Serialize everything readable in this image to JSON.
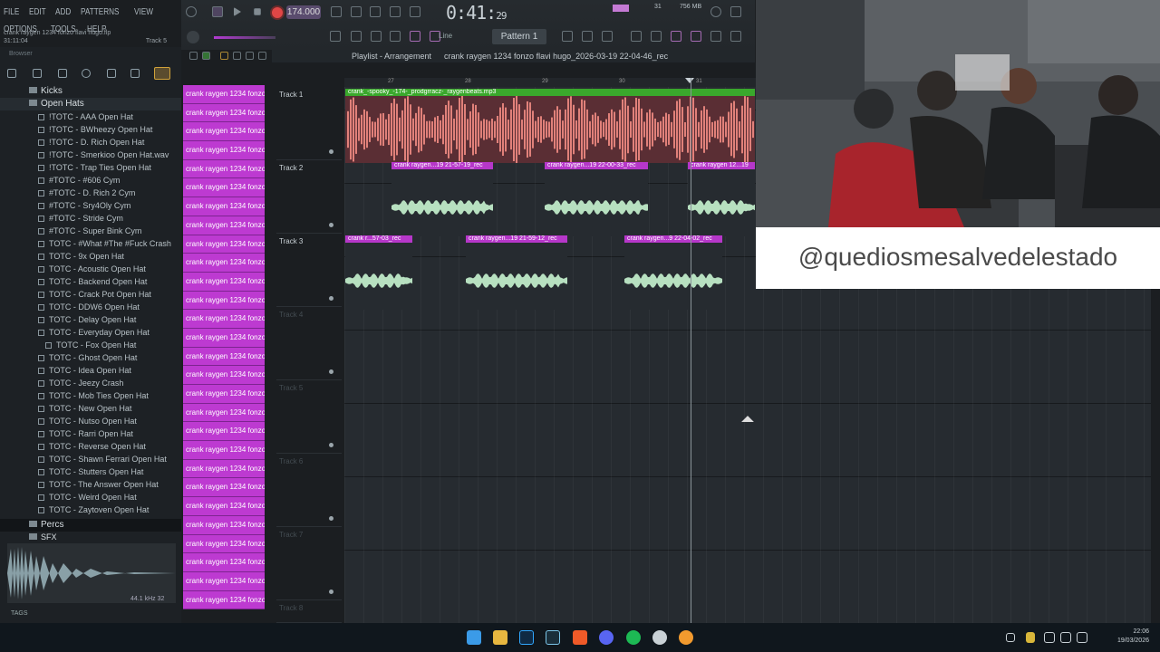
{
  "menu": [
    "FILE",
    "EDIT",
    "ADD",
    "PATTERNS",
    "VIEW",
    "OPTIONS",
    "TOOLS",
    "HELP"
  ],
  "hint": {
    "file": "crank raygen 1234 fonzo flavi hugo.flp",
    "time": "31:11:04",
    "track": "Track 5"
  },
  "transport": {
    "tempo": "174.000",
    "time": "0:41",
    "time_small": "29",
    "pattern": "Pattern 1",
    "snap": "Line",
    "mem": "756 MB",
    "cpu": "31"
  },
  "playlist": {
    "title": "Playlist - Arrangement",
    "name": "crank raygen 1234 fonzo flavi hugo_2026-03-19 22-04-46_rec",
    "bars": [
      "27",
      "28",
      "29",
      "30",
      "31"
    ]
  },
  "browser": {
    "label": "Browser",
    "folders": {
      "kicks": "Kicks",
      "open_hats": "Open Hats",
      "percs": "Percs",
      "sfx": "SFX"
    },
    "items": [
      "!TOTC - AAA Open Hat",
      "!TOTC - BWheezy Open Hat",
      "!TOTC - D. Rich Open Hat",
      "!TOTC - Smerkioo Open Hat.wav",
      "!TOTC - Trap Ties Open Hat",
      "#TOTC - #606 Cym",
      "#TOTC - D. Rich 2 Cym",
      "#TOTC - Sry4Oly Cym",
      "#TOTC - Stride Cym",
      "#TOTC - Super Bink Cym",
      "TOTC - #What #The #Fuck Crash",
      "TOTC - 9x Open Hat",
      "TOTC - Acoustic Open Hat",
      "TOTC - Backend Open Hat",
      "TOTC - Crack Pot Open Hat",
      "TOTC - DDW6 Open Hat",
      "TOTC - Delay Open Hat",
      "TOTC - Everyday Open Hat",
      "TOTC - Fox Open Hat",
      "TOTC - Ghost Open Hat",
      "TOTC - Idea Open Hat",
      "TOTC - Jeezy Crash",
      "TOTC - Mob Ties Open Hat",
      "TOTC - New Open Hat",
      "TOTC - Nutso Open Hat",
      "TOTC - Rarri Open Hat",
      "TOTC - Reverse Open Hat",
      "TOTC - Shawn Ferrari Open Hat",
      "TOTC - Stutters Open Hat",
      "TOTC - The Answer Open Hat",
      "TOTC - Weird Open Hat",
      "TOTC - Zaytoven Open Hat"
    ],
    "sample_info": "44.1 kHz 32",
    "tags": "TAGS"
  },
  "channel_label": "crank raygen 1234 fonzo...",
  "tracks": [
    "Track 1",
    "Track 2",
    "Track 3",
    "Track 4",
    "Track 5",
    "Track 6",
    "Track 7",
    "Track 8"
  ],
  "clips": {
    "t1": "crank_-spooky_-174-_prodgrracz-_raygenbeats.mp3",
    "t2": [
      "crank raygen...19 21-57-19_rec",
      "crank raygen...19 22-00-33_rec",
      "crank raygen 12...19"
    ],
    "t3": [
      "crank r...57-03_rec",
      "crank raygen...19 21-59-12_rec",
      "crank raygen...9 22-04-02_rec"
    ]
  },
  "overlay": "@quediosmesalvedelestado",
  "clock": {
    "time": "22:06",
    "date": "19/03/2026"
  },
  "colors": {
    "channel": "#bd3ad1",
    "clip_header": "#3aa82c",
    "audio_header": "#b637c9",
    "wave_red": "#f08b82",
    "wave_green": "#b7e0c0"
  }
}
